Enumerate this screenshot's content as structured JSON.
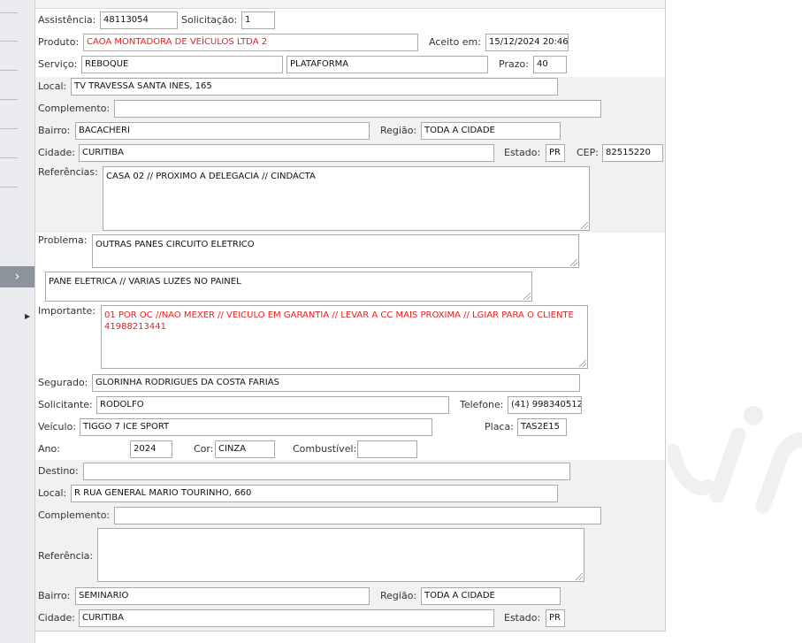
{
  "sidebar": {
    "toggle_icon": "chevron-right-icon",
    "arrow_icon": "triangle-right-icon"
  },
  "form": {
    "assistencia": {
      "label": "Assistência:",
      "value": "48113054"
    },
    "solicitacao": {
      "label": "Solicitação:",
      "value": "1"
    },
    "produto": {
      "label": "Produto:",
      "value": "CAOA MONTADORA DE VEÍCULOS LTDA 2"
    },
    "aceito_em": {
      "label": "Aceito em:",
      "value": "15/12/2024 20:46"
    },
    "servico": {
      "label": "Serviço:",
      "value": "REBOQUE",
      "value2": "PLATAFORMA"
    },
    "prazo": {
      "label": "Prazo:",
      "value": "40"
    },
    "origem": {
      "local": {
        "label": "Local:",
        "value": "TV TRAVESSA SANTA INES, 165"
      },
      "complemento": {
        "label": "Complemento:",
        "value": ""
      },
      "bairro": {
        "label": "Bairro:",
        "value": "BACACHERI"
      },
      "regiao": {
        "label": "Região:",
        "value": "TODA A CIDADE"
      },
      "cidade": {
        "label": "Cidade:",
        "value": "CURITIBA"
      },
      "estado": {
        "label": "Estado:",
        "value": "PR"
      },
      "cep": {
        "label": "CEP:",
        "value": "82515220"
      },
      "referencias": {
        "label": "Referências:",
        "value": "CASA 02 // PROXIMO A DELEGACIA // CINDACTA"
      }
    },
    "problema": {
      "label": "Problema:",
      "value": "OUTRAS PANES CIRCUITO ELETRICO",
      "detail": "PANE ELETRICA // VARIAS LUZES NO PAINEL"
    },
    "importante": {
      "label": "Importante:",
      "value": "01 POR OC //NAO MEXER // VEICULO EM GARANTIA // LEVAR A CC MAIS PROXIMA // LGIAR PARA O CLIENTE 41988213441"
    },
    "segurado": {
      "label": "Segurado:",
      "value": "GLORINHA RODRIGUES DA COSTA FARIAS"
    },
    "solicitante": {
      "label": "Solicitante:",
      "value": "RODOLFO"
    },
    "telefone": {
      "label": "Telefone:",
      "value": "(41) 998340512"
    },
    "veiculo": {
      "label": "Veículo:",
      "value": "TIGGO 7 ICE SPORT"
    },
    "placa": {
      "label": "Placa:",
      "value": "TAS2E15"
    },
    "ano": {
      "label": "Ano:",
      "value": "2024"
    },
    "cor": {
      "label": "Cor:",
      "value": "CINZA"
    },
    "combustivel": {
      "label": "Combustível:",
      "value": ""
    },
    "destino": {
      "destino": {
        "label": "Destino:",
        "value": ""
      },
      "local": {
        "label": "Local:",
        "value": "R RUA GENERAL MARIO TOURINHO, 660"
      },
      "complemento": {
        "label": "Complemento:",
        "value": ""
      },
      "referencia": {
        "label": "Referência:",
        "value": ""
      },
      "bairro": {
        "label": "Bairro:",
        "value": "SEMINARIO"
      },
      "regiao": {
        "label": "Região:",
        "value": "TODA A CIDADE"
      },
      "cidade": {
        "label": "Cidade:",
        "value": "CURITIBA"
      },
      "estado": {
        "label": "Estado:",
        "value": "PR"
      }
    }
  },
  "colors": {
    "accent_red": "#e32222",
    "band_gray": "#f1f1f1",
    "sidebar": "#e9ebee"
  }
}
